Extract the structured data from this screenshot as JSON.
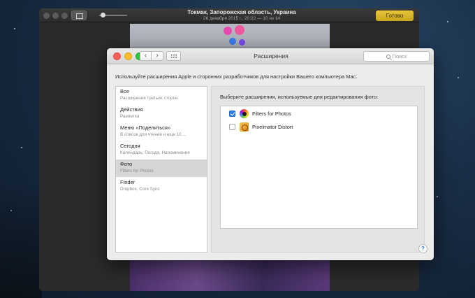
{
  "photos": {
    "location_title": "Токмак, Запорожская область, Украина",
    "subtitle": "26 декабря 2015 г., 20:22  —  10 из 14",
    "done_label": "Готово"
  },
  "prefs": {
    "title": "Расширения",
    "search_placeholder": "Поиск",
    "intro": "Используйте расширения Apple и сторонних разработчиков для настройки Вашего компьютера Mac.",
    "extensions": [
      {
        "name": "Все",
        "desc": "Расширения третьих сторон",
        "selected": false
      },
      {
        "name": "Действия",
        "desc": "Разметка",
        "selected": false
      },
      {
        "name": "Меню «Поделиться»",
        "desc": "В список для чтения и еще 10 ...",
        "selected": false
      },
      {
        "name": "Сегодня",
        "desc": "Календарь, Погода, Напоминания",
        "selected": false
      },
      {
        "name": "Фото",
        "desc": "Filters for Photos",
        "selected": true
      },
      {
        "name": "Finder",
        "desc": "Dropbox, Core Sync",
        "selected": false
      }
    ],
    "right_heading": "Выберите расширения, используемые для редактирования фото:",
    "photo_extensions": [
      {
        "name": "Filters for Photos",
        "checked": true,
        "icon": "filters-icon"
      },
      {
        "name": "Pixelmator Distort",
        "checked": false,
        "icon": "pixelmator-icon"
      }
    ],
    "help_label": "?"
  },
  "colors": {
    "accent_blue": "#2b7de9",
    "done_yellow": "#d9b62a",
    "selected_row": "#d6d6d6"
  }
}
